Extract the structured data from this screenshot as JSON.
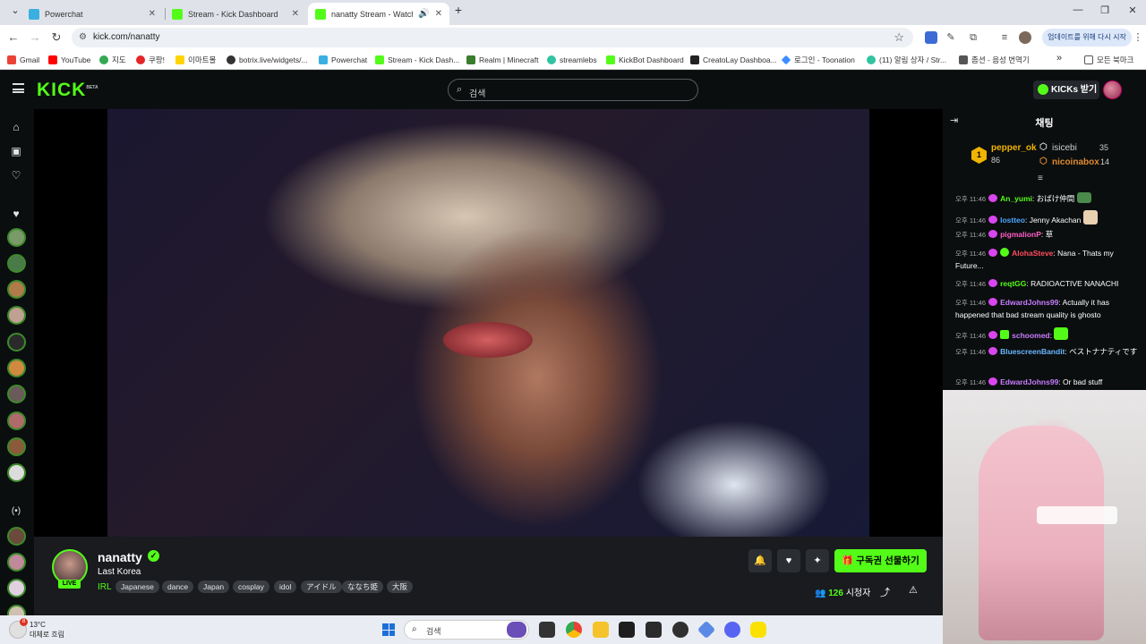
{
  "browser": {
    "tabs": [
      {
        "title": "Powerchat"
      },
      {
        "title": "Stream - Kick Dashboard"
      },
      {
        "title": "nanatty Stream - Watch Li"
      }
    ],
    "url": "kick.com/nanatty",
    "update_label": "업데이트를 위해 다시 시작",
    "bookmarks": [
      {
        "label": "Gmail",
        "color": "#ea4335"
      },
      {
        "label": "YouTube",
        "color": "#ff0000"
      },
      {
        "label": "지도",
        "color": "#34a853"
      },
      {
        "label": "쿠팡!",
        "color": "#e52528"
      },
      {
        "label": "이마트몰",
        "color": "#ffd400"
      },
      {
        "label": "botrix.live/widgets/...",
        "color": "#333333"
      },
      {
        "label": "Powerchat",
        "color": "#3bb0e0"
      },
      {
        "label": "Stream - Kick Dash...",
        "color": "#53fc18"
      },
      {
        "label": "Realm | Minecraft",
        "color": "#3a7d2c"
      },
      {
        "label": "streamlebs",
        "color": "#31c3a2"
      },
      {
        "label": "KickBot Dashboard",
        "color": "#53fc18"
      },
      {
        "label": "CreatoLay Dashboa...",
        "color": "#222222"
      },
      {
        "label": "로그인 - Toonation",
        "color": "#3c8dff"
      },
      {
        "label": "(11) 알림 상자 / Str...",
        "color": "#31c3a2"
      },
      {
        "label": "좀션 - 음성 번역기",
        "color": "#555555"
      }
    ],
    "bookmarks_more": "»",
    "all_bookmarks": "모든 북마크"
  },
  "kick": {
    "logo": "KICK",
    "beta": "BETA",
    "search_placeholder": "검색",
    "kicks_button": "KICKs 받기"
  },
  "channel": {
    "name": "nanatty",
    "live_label": "LIVE",
    "stream_title": "Last Korea",
    "category": "IRL",
    "tags": [
      "Japanese",
      "dance",
      "Japan",
      "cosplay",
      "idol",
      "アイドル",
      "ななち姫",
      "大阪"
    ],
    "gift_button": "구독권 선물하기",
    "viewer_count": "126",
    "viewer_suffix": "시청자"
  },
  "chat": {
    "title": "채팅",
    "leaderboard": {
      "rank1": {
        "rank": "1",
        "name": "pepper_ok",
        "value": "86"
      },
      "rank2": {
        "name": "isicebi",
        "value": "35"
      },
      "rank3": {
        "name": "nicoinabox",
        "value": "14"
      }
    },
    "messages": [
      {
        "time": "오후 11:46",
        "user": "An_yumi",
        "color": "#53fc18",
        "text": "おばけ仲間"
      },
      {
        "time": "오후 11:46",
        "user": "lostteo",
        "color": "#4aa8ff",
        "text": "Jenny Akachan"
      },
      {
        "time": "오후 11:46",
        "user": "pigmalionP",
        "color": "#ff5ec4",
        "text": "草"
      },
      {
        "time": "오후 11:46",
        "user": "AlohaSteve",
        "color": "#ff4d5e",
        "text": "Nana - Thats my Future..."
      },
      {
        "time": "오후 11:46",
        "user": "reqtGG",
        "color": "#53fc18",
        "text": "RADIOACTIVE NANACHI"
      },
      {
        "time": "오후 11:46",
        "user": "EdwardJohns99",
        "color": "#c77dff",
        "text": "Actually it has happened that bad stream quality is ghosto"
      },
      {
        "time": "오후 11:46",
        "user": "schoomed",
        "color": "#c77dff",
        "text": ""
      },
      {
        "time": "오후 11:46",
        "user": "BluescreenBandit",
        "color": "#6ab7ff",
        "text": "ベストナナティです"
      },
      {
        "time": "오후 11:46",
        "user": "EdwardJohns99",
        "color": "#c77dff",
        "text": "Or bad stuff"
      }
    ]
  },
  "taskbar": {
    "weather_badge": "8",
    "temperature": "13°C",
    "weather_desc": "대체로 흐림",
    "search_placeholder": "검색"
  }
}
